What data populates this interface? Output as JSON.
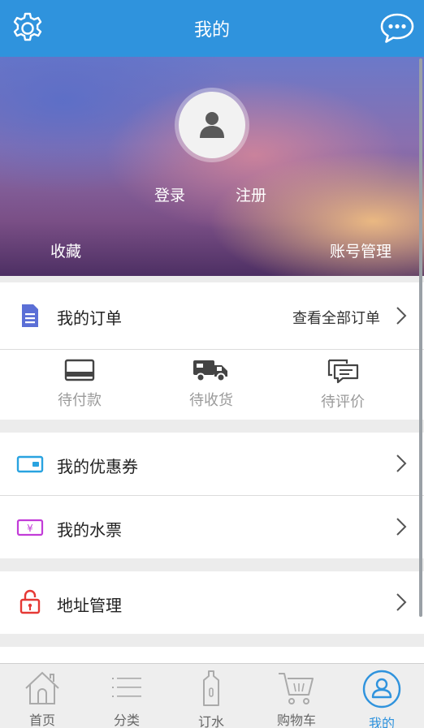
{
  "header": {
    "title": "我的",
    "left_icon": "gear-icon",
    "right_icon": "chat-icon",
    "color": "#2f93dd"
  },
  "profile": {
    "login": "登录",
    "register": "注册",
    "favorites": "收藏",
    "account_manage": "账号管理"
  },
  "orders": {
    "title": "我的订单",
    "view_all": "查看全部订单",
    "statuses": [
      {
        "label": "待付款",
        "icon": "card-icon"
      },
      {
        "label": "待收货",
        "icon": "truck-icon"
      },
      {
        "label": "待评价",
        "icon": "review-icon"
      }
    ]
  },
  "menu": {
    "coupons": "我的优惠券",
    "water_tickets": "我的水票",
    "address": "地址管理"
  },
  "tabs": [
    {
      "label": "首页",
      "icon": "home-icon"
    },
    {
      "label": "分类",
      "icon": "category-icon"
    },
    {
      "label": "订水",
      "icon": "water-bottle-icon"
    },
    {
      "label": "购物车",
      "icon": "cart-icon"
    },
    {
      "label": "我的",
      "icon": "profile-icon",
      "active": true
    }
  ]
}
